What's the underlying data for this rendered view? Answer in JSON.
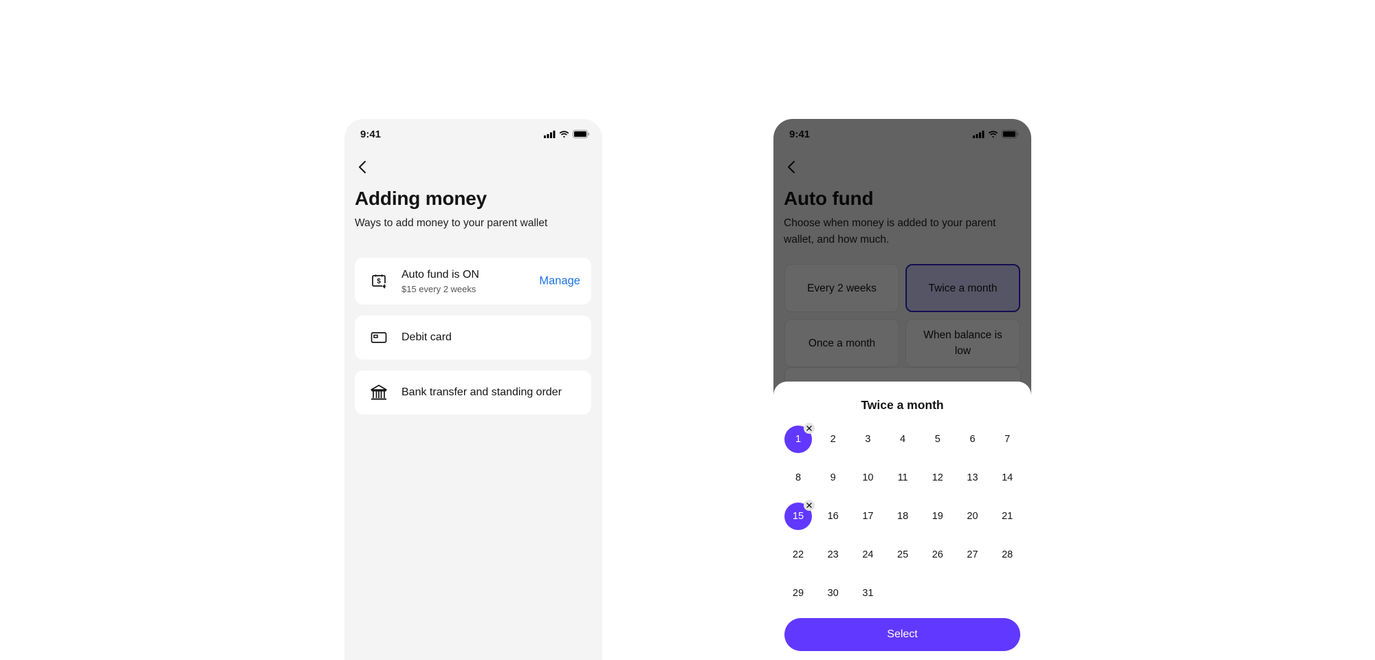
{
  "left_screen": {
    "status": {
      "time": "9:41"
    },
    "title": "Adding money",
    "subtitle": "Ways to add money to your parent wallet",
    "methods": [
      {
        "icon": "calendar-dollar-icon",
        "label": "Auto fund is ON",
        "sublabel": "$15 every 2 weeks",
        "action": "Manage"
      },
      {
        "icon": "debit-card-icon",
        "label": "Debit card"
      },
      {
        "icon": "bank-icon",
        "label": "Bank transfer and standing order"
      }
    ]
  },
  "right_screen": {
    "status": {
      "time": "9:41"
    },
    "title": "Auto fund",
    "subtitle": "Choose when money is added to your parent wallet, and how much.",
    "frequency_options": [
      {
        "label": "Every 2 weeks",
        "selected": false
      },
      {
        "label": "Twice a month",
        "selected": true
      },
      {
        "label": "Once a month",
        "selected": false
      },
      {
        "label": "When balance is low",
        "selected": false
      }
    ],
    "sheet": {
      "title": "Twice a month",
      "days": [
        "1",
        "2",
        "3",
        "4",
        "5",
        "6",
        "7",
        "8",
        "9",
        "10",
        "11",
        "12",
        "13",
        "14",
        "15",
        "16",
        "17",
        "18",
        "19",
        "20",
        "21",
        "22",
        "23",
        "24",
        "25",
        "26",
        "27",
        "28",
        "29",
        "30",
        "31"
      ],
      "selected_days": [
        "1",
        "15"
      ],
      "select_label": "Select"
    }
  },
  "colors": {
    "accent": "#6138ff",
    "link": "#1a73e8",
    "selected_border": "#3a22c8"
  }
}
